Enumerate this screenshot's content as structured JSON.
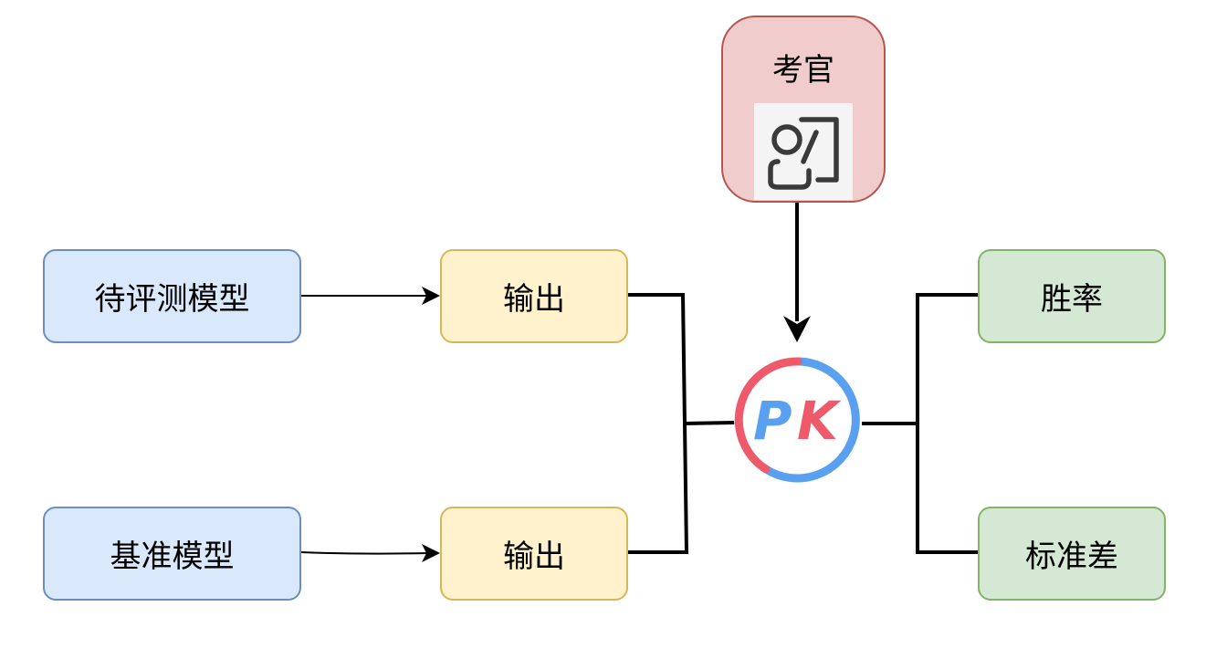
{
  "nodes": {
    "model_under_test": "待评测模型",
    "baseline_model": "基准模型",
    "output_top": "输出",
    "output_bottom": "输出",
    "judge": "考官",
    "win_rate": "胜率",
    "std_dev": "标准差"
  },
  "pk_badge": {
    "text_p": "P",
    "text_k": "K",
    "colors": {
      "red": "#ee5a6a",
      "blue": "#5aa0f0"
    }
  },
  "icons": {
    "judge_icon": "teacher-presenting-icon",
    "pk_icon": "pk-versus-icon"
  },
  "colors": {
    "input_fill": "#dae8fc",
    "input_border": "#6c8ebf",
    "output_fill": "#fff2cc",
    "output_border": "#d6b656",
    "result_fill": "#d5e8d4",
    "result_border": "#82b366",
    "judge_fill": "#f0cdcc",
    "judge_border": "#b85450"
  }
}
